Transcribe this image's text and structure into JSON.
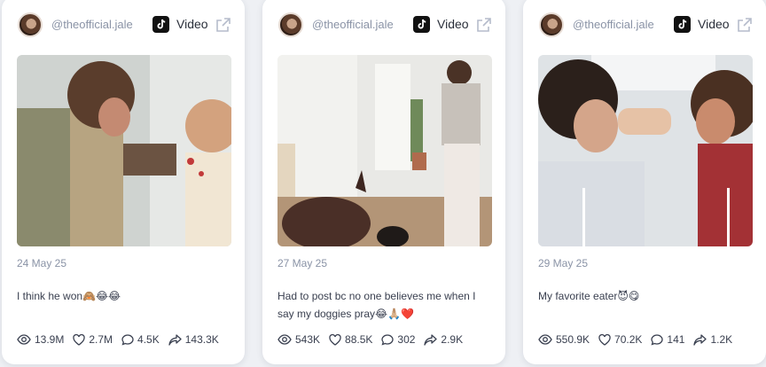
{
  "colors": {
    "accent": "#111111",
    "muted": "#8a93a6",
    "text": "#3a4050"
  },
  "cards": [
    {
      "username": "@theofficial.jale",
      "platform_icon": "tiktok-icon",
      "type": "Video",
      "date": "24 May 25",
      "caption": "I think he won🙈😂😂",
      "stats": {
        "views": "13.9M",
        "likes": "2.7M",
        "comments": "4.5K",
        "shares": "143.3K"
      }
    },
    {
      "username": "@theofficial.jale",
      "platform_icon": "tiktok-icon",
      "type": "Video",
      "date": "27 May 25",
      "caption": "Had to post bc no one believes me when I say my doggies pray😂🙏🏼❤️",
      "stats": {
        "views": "543K",
        "likes": "88.5K",
        "comments": "302",
        "shares": "2.9K"
      }
    },
    {
      "username": "@theofficial.jale",
      "platform_icon": "tiktok-icon",
      "type": "Video",
      "date": "29 May 25",
      "caption": "My favorite eater😈😋",
      "stats": {
        "views": "550.9K",
        "likes": "70.2K",
        "comments": "141",
        "shares": "1.2K"
      }
    }
  ]
}
